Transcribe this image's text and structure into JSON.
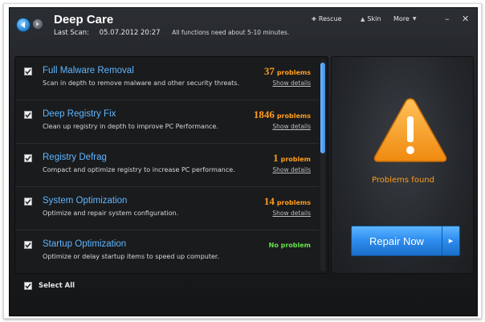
{
  "app": {
    "title": "Deep Care",
    "last_scan_label": "Last Scan:",
    "last_scan_value": "05.07.2012 20:27",
    "scan_note": "All functions need about 5-10 minutes."
  },
  "top_menu": {
    "rescue": "Rescue",
    "skin": "Skin",
    "more": "More"
  },
  "items": [
    {
      "title": "Full Malware Removal",
      "desc": "Scan in depth to remove malware and other security threats.",
      "count": "37",
      "unit": "problems",
      "link": "Show details",
      "checked": true
    },
    {
      "title": "Deep Registry Fix",
      "desc": "Clean up registry in depth to improve PC Performance.",
      "count": "1846",
      "unit": "problems",
      "link": "Show details",
      "checked": true
    },
    {
      "title": "Registry Defrag",
      "desc": "Compact and optimize registry to increase PC performance.",
      "count": "1",
      "unit": "problem",
      "link": "Show details",
      "checked": true
    },
    {
      "title": "System Optimization",
      "desc": "Optimize and repair system configuration.",
      "count": "14",
      "unit": "problems",
      "link": "Show details",
      "checked": true
    },
    {
      "title": "Startup Optimization",
      "desc": "Optimize or delay startup items to speed up computer.",
      "status": "No problem",
      "checked": true
    }
  ],
  "select_all": {
    "label": "Select All",
    "checked": true
  },
  "right_panel": {
    "status": "Problems found",
    "repair_label": "Repair Now"
  },
  "colors": {
    "accent_blue": "#5fb6ff",
    "problem_orange": "#ff9d1c",
    "ok_green": "#66e04a",
    "button_blue": "#2f8ef0"
  },
  "icons": {
    "back": "back-arrow-icon",
    "forward": "forward-arrow-icon",
    "rescue": "rescue-icon",
    "skin": "skin-icon",
    "warning": "warning-triangle-icon",
    "checkbox": "checkmark-icon"
  }
}
